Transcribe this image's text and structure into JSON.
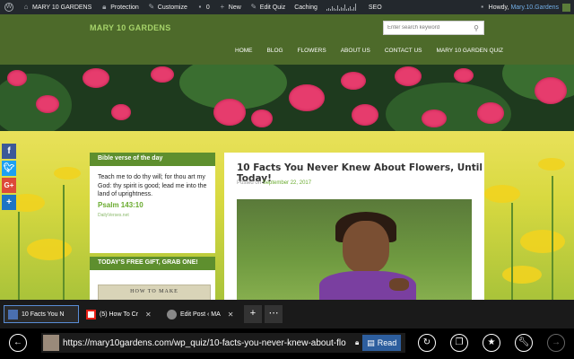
{
  "adminbar": {
    "site_name": "MARY 10 GARDENS",
    "protection": "Protection",
    "customize": "Customize",
    "comments_count": "0",
    "new": "New",
    "edit_quiz": "Edit Quiz",
    "caching": "Caching",
    "seo": "SEO",
    "howdy": "Howdy,",
    "user": "Mary.10.Gardens"
  },
  "header": {
    "site_title": "MARY 10 GARDENS",
    "search_placeholder": "Enter search keyword",
    "nav": [
      "HOME",
      "BLOG",
      "FLOWERS",
      "ABOUT US",
      "CONTACT US",
      "MARY 10 GARDEN QUIZ"
    ]
  },
  "social": {
    "facebook": "f",
    "googleplus": "G+",
    "share": "+"
  },
  "sidebar": {
    "verse_title": "Bible verse of the day",
    "verse_text": "Teach me to do thy will; for thou art my God: thy spirit is good; lead me into the land of uprightness.",
    "verse_ref": "Psalm 143:10",
    "verse_credit": "DailyVerses.net",
    "gift_title": "TODAY'S FREE GIFT, GRAB ONE!",
    "gift_book": "HOW TO MAKE"
  },
  "article": {
    "title": "10 Facts You Never Knew About Flowers, Until Today!",
    "posted_on": "Posted on",
    "date": "September 22, 2017"
  },
  "browser": {
    "tabs": [
      {
        "label": "10 Facts You N",
        "active": true
      },
      {
        "label": "(5) How To Cr",
        "active": false
      },
      {
        "label": "Edit Post ‹ MA",
        "active": false
      }
    ],
    "new_tab": "+",
    "more_tabs": "⋯",
    "url": "https://mary10gardens.com/wp_quiz/10-facts-you-never-knew-about-flo",
    "read_label": "Read"
  },
  "colors": {
    "header_green": "#4d6a2a",
    "widget_green": "#5e8f2e",
    "link_green": "#6aab2f",
    "admin_bar": "#23282d"
  }
}
